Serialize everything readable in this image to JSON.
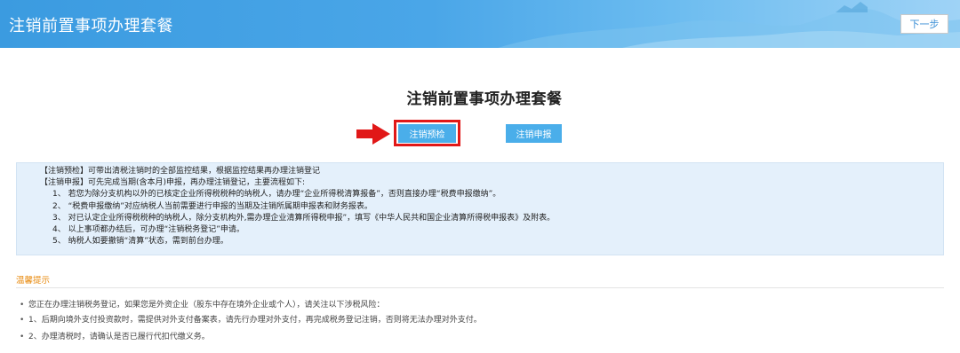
{
  "header": {
    "title": "注销前置事项办理套餐",
    "next_label": "下一步"
  },
  "main": {
    "title": "注销前置事项办理套餐",
    "precheck_label": "注销预检",
    "declare_label": "注销申报"
  },
  "notice": {
    "line1": "【注销预检】可带出清税注销时的全部监控结果，根据监控结果再办理注销登记",
    "line2": "【注销申报】可先完成当期(含本月)申报，再办理注销登记，主要流程如下:",
    "steps": [
      "1、 若您为除分支机构以外的已核定企业所得税税种的纳税人，请办理“企业所得税清算报备”，否则直接办理“税费申报缴纳”。",
      "2、 “税费申报缴纳”对应纳税人当前需要进行申报的当期及注销所属期申报表和财务报表。",
      "3、 对已认定企业所得税税种的纳税人，除分支机构外,需办理企业清算所得税申报”，填写《中华人民共和国企业清算所得税申报表》及附表。",
      "4、 以上事项都办结后，可办理“注销税务登记”申请。",
      "5、 纳税人如要撤销“清算”状态，需到前台办理。"
    ]
  },
  "tips": {
    "title": "温馨提示",
    "items": [
      "您正在办理注销税务登记，如果您是外资企业（股东中存在境外企业或个人），请关注以下涉税风险：",
      "1、后期向境外支付投资款时，需提供对外支付备案表，请先行办理对外支付，再完成税务登记注销，否则将无法办理对外支付。",
      "2、办理清税时，请确认是否已履行代扣代缴义务。"
    ]
  },
  "colors": {
    "header_blue": "#3b9be0",
    "button_blue": "#4aaeea",
    "highlight_red": "#e11818",
    "notice_bg": "#e4f0fb",
    "tip_orange": "#e8890c"
  }
}
